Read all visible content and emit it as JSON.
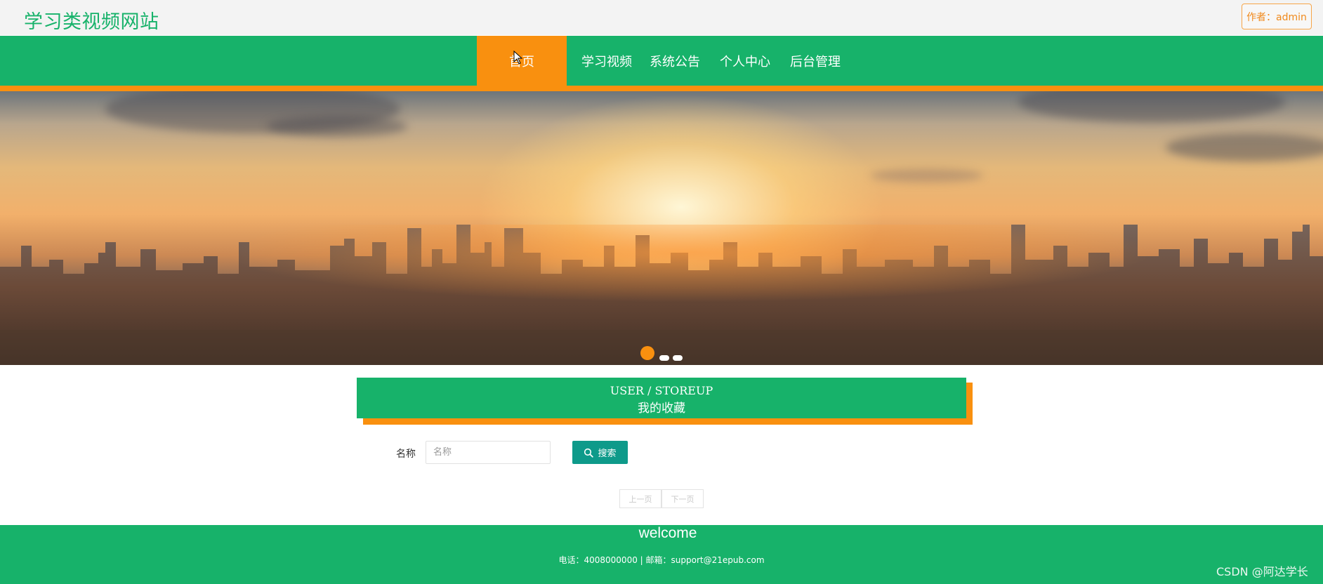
{
  "header": {
    "site_title": "学习类视频网站",
    "author_button": "作者：admin"
  },
  "nav": {
    "items": [
      {
        "label": "首页",
        "active": true
      },
      {
        "label": "学习视频",
        "active": false
      },
      {
        "label": "系统公告",
        "active": false
      },
      {
        "label": "个人中心",
        "active": false
      },
      {
        "label": "后台管理",
        "active": false
      }
    ]
  },
  "banner": {
    "slides_count": 3,
    "active_slide": 1
  },
  "section": {
    "title_en": "USER / STOREUP",
    "title_cn": "我的收藏"
  },
  "search": {
    "field_label": "名称",
    "placeholder": "名称",
    "value": "",
    "button_label": "搜索",
    "button_icon": "search-icon"
  },
  "pagination": {
    "prev_label": "上一页",
    "next_label": "下一页"
  },
  "footer": {
    "welcome": "welcome",
    "contact": "电话：4008000000 | 邮箱：support@21epub.com"
  },
  "watermark": "CSDN @阿达学长",
  "colors": {
    "primary_green": "#17b26a",
    "accent_orange": "#f9900f",
    "teal_button": "#0e9a8a"
  }
}
